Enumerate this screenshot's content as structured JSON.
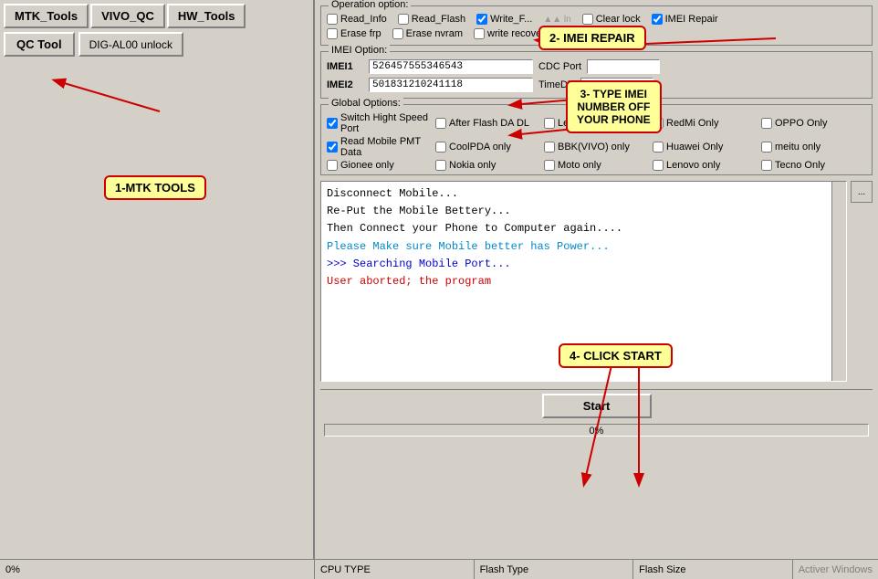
{
  "left_panel": {
    "tab_buttons": [
      "MTK_Tools",
      "VIVO_QC",
      "HW_Tools"
    ],
    "qc_tool_label": "QC Tool",
    "dig_button_label": "DIG-AL00 unlock"
  },
  "operation_option": {
    "group_label": "Operation option:",
    "row1": [
      "Read_Info",
      "Read_Flash",
      "Write_Flash",
      "Clear lock",
      "IMEI Repair"
    ],
    "row2": [
      "Erase frp",
      "Erase nvram",
      "write recovery"
    ]
  },
  "imei_option": {
    "group_label": "IMEI Option:",
    "imei1_label": "IMEI1",
    "imei1_value": "526457555346543",
    "imei2_label": "IMEI2",
    "imei2_value": "501831210241118",
    "cdc_label": "CDC Port",
    "time_label": "TimeDiff"
  },
  "global_options": {
    "group_label": "Global Options:",
    "items": [
      "Switch Hight Speed Port",
      "After Flash DA DL",
      "LeEco(letv) Only",
      "RedMi Only",
      "OPPO Only",
      "Read Mobile PMT Data",
      "CoolPDA only",
      "BBK(VIVO) only",
      "Huawei Only",
      "meitu only",
      "Gionee only",
      "Nokia only",
      "Moto only",
      "Lenovo only",
      "Tecno Only"
    ],
    "checked": [
      0,
      1
    ]
  },
  "console": {
    "lines": [
      {
        "text": "Disconnect Mobile...",
        "color": "white"
      },
      {
        "text": "Re-Put the Mobile Bettery...",
        "color": "white"
      },
      {
        "text": "Then Connect your Phone to Computer again....",
        "color": "white"
      },
      {
        "text": "Please Make sure Mobile better has Power...",
        "color": "cyan"
      },
      {
        "text": ">>> Searching Mobile Port...",
        "color": "blue"
      },
      {
        "text": "User aborted; the program",
        "color": "red"
      }
    ]
  },
  "start_button_label": "Start",
  "status_bar": {
    "progress_text": "0%"
  },
  "bottom_bar": {
    "left_status": "0%",
    "cpu_type_label": "CPU TYPE",
    "flash_type_label": "Flash Type",
    "flash_size_label": "Flash Size",
    "windows_label": "Activer Windows"
  },
  "callouts": {
    "imei_repair": "2- IMEI REPAIR",
    "type_imei": "3- TYPE IMEI\nNUMBER OFF\nYOUR PHONE",
    "click_start": "4- CLICK START",
    "mtk_tools": "1-MTK TOOLS"
  }
}
